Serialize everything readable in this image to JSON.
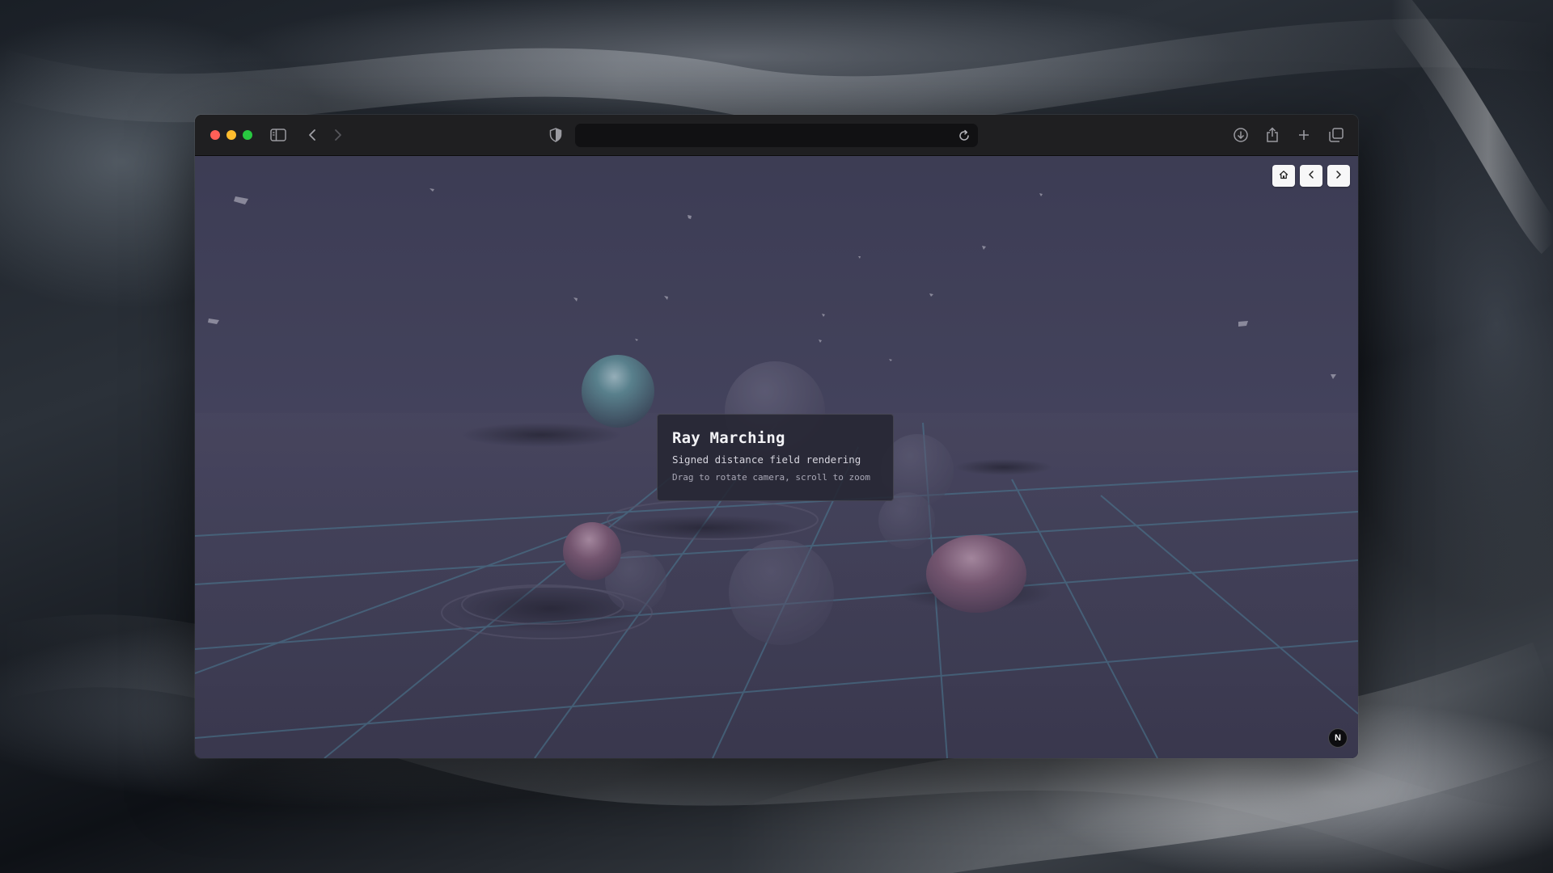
{
  "browser": {
    "address_value": "",
    "icons": [
      "close",
      "minimize",
      "maximize",
      "sidebar-icon",
      "back-icon",
      "forward-icon",
      "shield-icon",
      "reload-icon",
      "download-icon",
      "share-icon",
      "new-tab-icon",
      "tabs-overview-icon"
    ]
  },
  "page": {
    "nav": {
      "home_icon": "home-icon",
      "prev_icon": "chevron-left-icon",
      "next_icon": "chevron-right-icon"
    },
    "card": {
      "title": "Ray Marching",
      "subtitle": "Signed distance field rendering",
      "hint": "Drag to rotate camera, scroll to zoom"
    },
    "badge": "N"
  },
  "colors": {
    "sky": "#3d3d55",
    "floor": "#403e55",
    "grid_line": "#4f8aa3",
    "sphere_teal": "#5f8f99",
    "sphere_pink": "#8a5f78"
  }
}
